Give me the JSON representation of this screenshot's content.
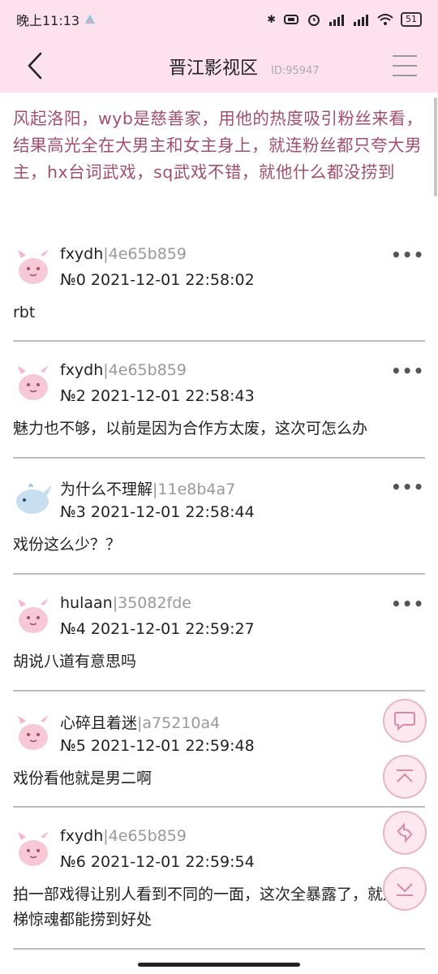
{
  "status_bar": {
    "time": "晚上11:13",
    "battery": "51"
  },
  "header": {
    "title": "晋江影视区",
    "board_id": "ID:95947"
  },
  "thread": {
    "title": "风起洛阳，wyb是慈善家，用他的热度吸引粉丝来看，结果高光全在大男主和女主身上，就连粉丝都只夸大男主，hx台词武戏，sq武戏不错，就他什么都没捞到"
  },
  "posts": [
    {
      "user": "fxydh",
      "uid": "|4e65b859",
      "meta": "№0  2021-12-01 22:58:02",
      "body": "rbt",
      "more": "•••",
      "avatar": "pink-creature"
    },
    {
      "user": "fxydh",
      "uid": "|4e65b859",
      "meta": "№2  2021-12-01 22:58:43",
      "body": "魅力也不够，以前是因为合作方太废，这次可怎么办",
      "more": "•••",
      "avatar": "pink-creature"
    },
    {
      "user": "为什么不理解",
      "uid": "|11e8b4a7",
      "meta": "№3  2021-12-01 22:58:44",
      "body": "戏份这么少？？",
      "more": "•••",
      "avatar": "whale"
    },
    {
      "user": "hulaan",
      "uid": "|35082fde",
      "meta": "№4  2021-12-01 22:59:27",
      "body": "胡说八道有意思吗",
      "more": "•••",
      "avatar": "pink-creature"
    },
    {
      "user": "心碎且着迷",
      "uid": "|a75210a4",
      "meta": "№5  2021-12-01 22:59:48",
      "body": "戏份看他就是男二啊",
      "more": "",
      "avatar": "pink-creature"
    },
    {
      "user": "fxydh",
      "uid": "|4e65b859",
      "meta": "№6  2021-12-01 22:59:54",
      "body": "拍一部戏得让别人看到不同的一面，这次全暴露了，就连电梯惊魂都能捞到好处",
      "more": "",
      "avatar": "pink-creature"
    }
  ],
  "floating_buttons": [
    "comment-icon",
    "scroll-top-icon",
    "refresh-icon",
    "scroll-bottom-icon"
  ]
}
